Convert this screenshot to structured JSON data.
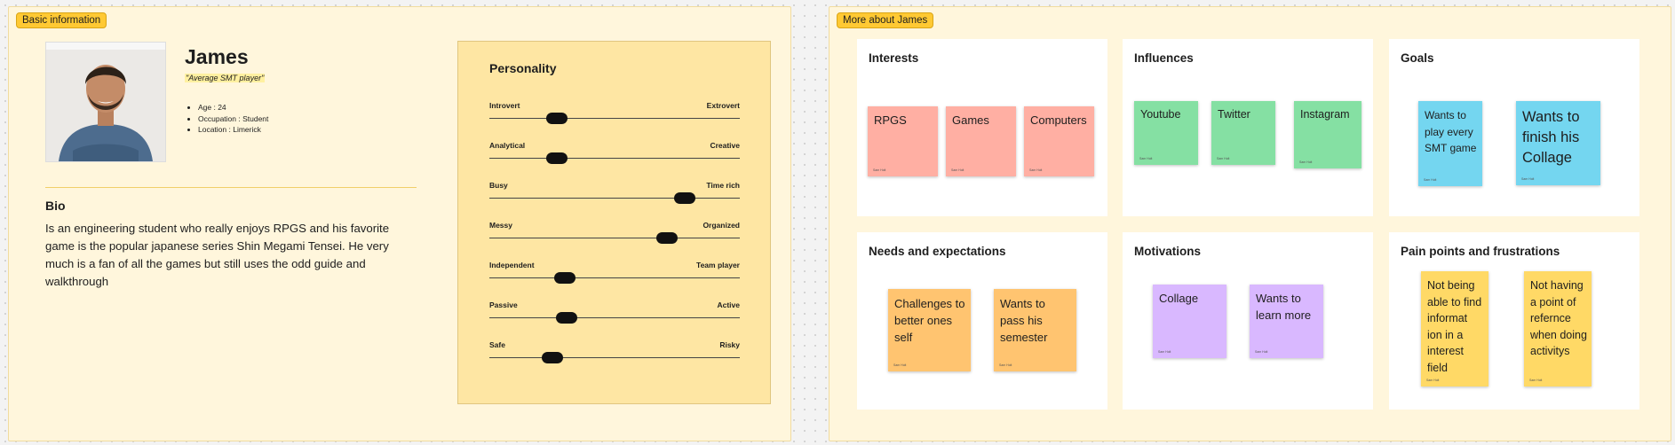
{
  "basic": {
    "tag": "Basic information",
    "name": "James",
    "tagline": "\"Average SMT player\"",
    "facts": [
      "Age : 24",
      "Occupation : Student",
      "Location : Limerick"
    ],
    "bio_title": "Bio",
    "bio_text": "Is an engineering student who really enjoys RPGS and his favorite game is the popular japanese series Shin Megami Tensei. He very much is a fan of all the games but still uses the odd guide and walkthrough"
  },
  "personality": {
    "title": "Personality",
    "traits": [
      {
        "left": "Introvert",
        "right": "Extrovert",
        "level": 0.27
      },
      {
        "left": "Analytical",
        "right": "Creative",
        "level": 0.27
      },
      {
        "left": "Busy",
        "right": "Time rich",
        "level": 0.78
      },
      {
        "left": "Messy",
        "right": "Organized",
        "level": 0.71
      },
      {
        "left": "Independent",
        "right": "Team player",
        "level": 0.3
      },
      {
        "left": "Passive",
        "right": "Active",
        "level": 0.31
      },
      {
        "left": "Safe",
        "right": "Risky",
        "level": 0.25
      }
    ]
  },
  "more": {
    "tag": "More about James",
    "author": "Sam Holt",
    "interests": {
      "title": "Interests",
      "notes": [
        "RPGS",
        "Games",
        "Computers"
      ]
    },
    "influences": {
      "title": "Influences",
      "notes": [
        "Youtube",
        "Twitter",
        "Instagram"
      ]
    },
    "goals": {
      "title": "Goals",
      "notes": [
        "Wants to play every SMT game",
        "Wants to finish his Collage"
      ]
    },
    "needs": {
      "title": "Needs and expectations",
      "notes": [
        "Challenges to better ones self",
        "Wants to pass his semester"
      ]
    },
    "motivations": {
      "title": "Motivations",
      "notes": [
        "Collage",
        "Wants to learn more"
      ]
    },
    "pain": {
      "title": "Pain points and frustrations",
      "notes": [
        "Not being able to find informat ion in a interest field",
        "Not having a point of refernce when doing activitys"
      ]
    }
  },
  "colors": {
    "section_bg": "#fff6dc",
    "tag_bg": "#ffc933",
    "personality_bg": "#fee6a3",
    "red_note": "#ffafa3",
    "green_note": "#85e0a3",
    "blue_note": "#74d6f0",
    "orange_note": "#ffc470",
    "purple_note": "#d9b8ff",
    "yellow_note": "#ffd966"
  }
}
